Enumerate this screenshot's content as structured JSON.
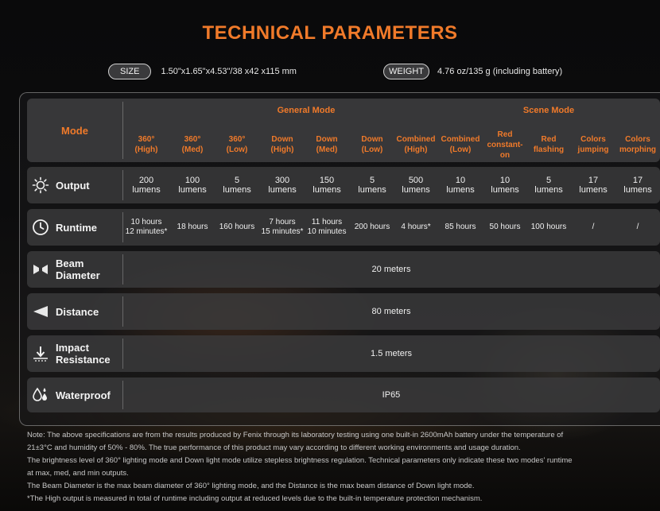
{
  "title": "TECHNICAL PARAMETERS",
  "size": {
    "label": "SIZE",
    "value": "1.50\"x1.65\"x4.53\"/38 x42 x115 mm"
  },
  "weight": {
    "label": "WEIGHT",
    "value": "4.76 oz/135 g (including battery)"
  },
  "table": {
    "mode_label": "Mode",
    "groups": {
      "general": "General Mode",
      "scene": "Scene Mode"
    },
    "columns": [
      [
        "360°",
        "(High)"
      ],
      [
        "360°",
        "(Med)"
      ],
      [
        "360°",
        "(Low)"
      ],
      [
        "Down",
        "(High)"
      ],
      [
        "Down",
        "(Med)"
      ],
      [
        "Down",
        "(Low)"
      ],
      [
        "Combined",
        "(High)"
      ],
      [
        "Combined",
        "(Low)"
      ],
      [
        "Red",
        "constant-",
        "on"
      ],
      [
        "Red",
        "flashing"
      ],
      [
        "Colors",
        "jumping"
      ],
      [
        "Colors",
        "morphing"
      ]
    ],
    "output": {
      "label": "Output",
      "values": [
        [
          "200",
          "lumens"
        ],
        [
          "100",
          "lumens"
        ],
        [
          "5",
          "lumens"
        ],
        [
          "300",
          "lumens"
        ],
        [
          "150",
          "lumens"
        ],
        [
          "5",
          "lumens"
        ],
        [
          "500",
          "lumens"
        ],
        [
          "10",
          "lumens"
        ],
        [
          "10",
          "lumens"
        ],
        [
          "5",
          "lumens"
        ],
        [
          "17",
          "lumens"
        ],
        [
          "17",
          "lumens"
        ]
      ]
    },
    "runtime": {
      "label": "Runtime",
      "values": [
        [
          "10 hours",
          "12 minutes*"
        ],
        [
          "18 hours"
        ],
        [
          "160 hours"
        ],
        [
          "7 hours",
          "15 minutes*"
        ],
        [
          "11 hours",
          "10 minutes"
        ],
        [
          "200 hours"
        ],
        [
          "4 hours*"
        ],
        [
          "85 hours"
        ],
        [
          "50 hours"
        ],
        [
          "100 hours"
        ],
        [
          "/"
        ],
        [
          "/"
        ]
      ]
    },
    "beam": {
      "label_1": "Beam",
      "label_2": "Diameter",
      "value": "20 meters"
    },
    "distance": {
      "label": "Distance",
      "value": "80 meters"
    },
    "impact": {
      "label_1": "Impact",
      "label_2": "Resistance",
      "value": "1.5 meters"
    },
    "waterproof": {
      "label": "Waterproof",
      "value": "IP65"
    }
  },
  "notes": [
    "Note: The above specifications are from the results produced by Fenix through its laboratory testing using one built-in 2600mAh battery under the temperature of",
    "21±3°C and humidity of 50% - 80%. The true performance of this product may vary according to different working environments and usage duration.",
    "The brightness level of 360° lighting mode and Down light mode utilize stepless brightness regulation. Technical parameters only indicate these two modes' runtime",
    "at max, med, and min outputs.",
    "The Beam Diameter is the max beam diameter of 360° lighting mode, and the Distance is the max beam distance of Down light mode.",
    "*The High output is measured in total of runtime including output at reduced levels due to the built-in temperature protection mechanism."
  ],
  "icons": [
    "sun-icon",
    "clock-icon",
    "beam-icon",
    "distance-icon",
    "impact-icon",
    "water-drops-icon"
  ],
  "colors": {
    "accent": "#f07a2a",
    "row_bg": "#3a3a3c"
  }
}
